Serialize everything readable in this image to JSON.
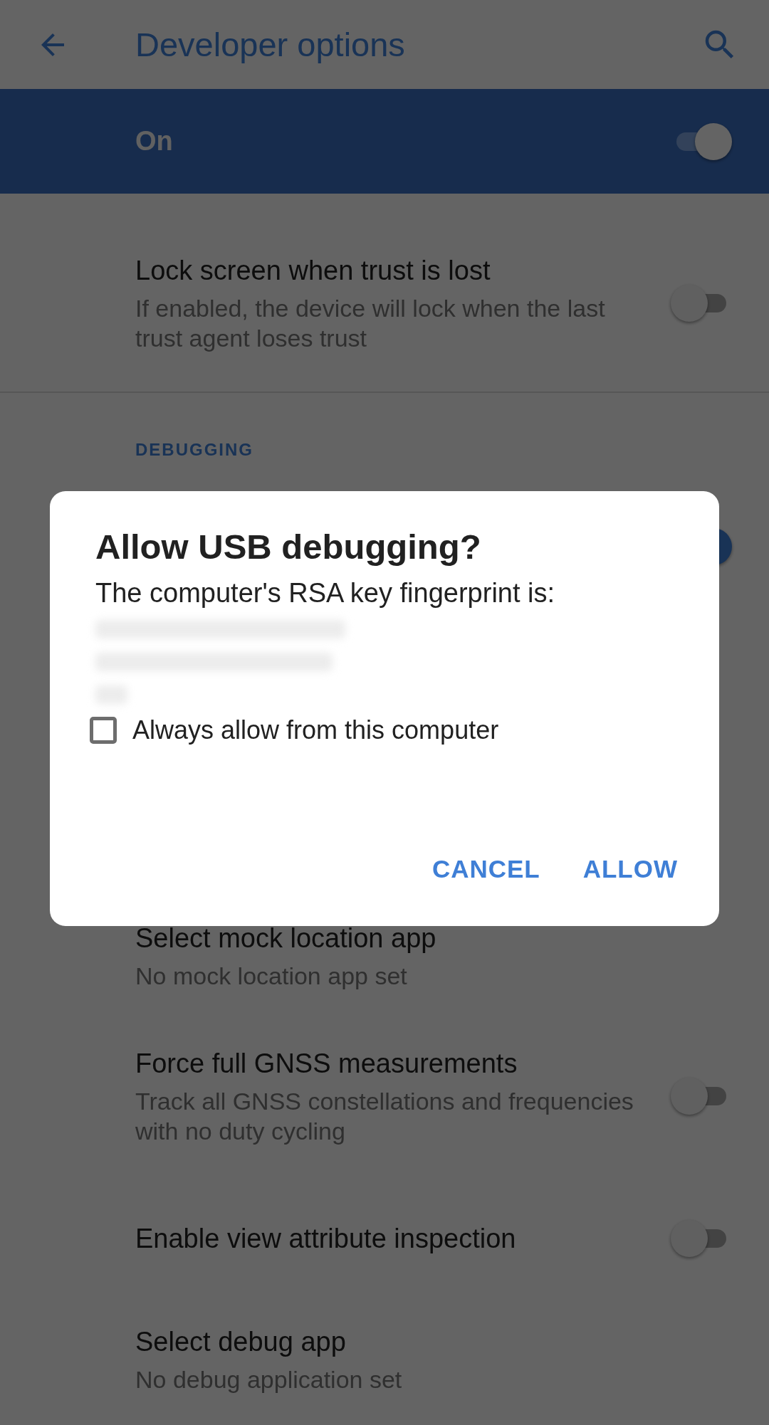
{
  "app_bar": {
    "title": "Developer options"
  },
  "main_switch": {
    "label": "On",
    "on": true
  },
  "settings": [
    {
      "kind": "toggle",
      "title": "Lock screen when trust is lost",
      "summary": "If enabled, the device will lock when the last trust agent loses trust",
      "on": false
    },
    {
      "kind": "header",
      "title": "DEBUGGING"
    },
    {
      "kind": "covered",
      "on": true
    },
    {
      "kind": "text",
      "title": "Select mock location app",
      "summary": "No mock location app set"
    },
    {
      "kind": "toggle",
      "title": "Force full GNSS measurements",
      "summary": "Track all GNSS constellations and frequencies with no duty cycling",
      "on": false
    },
    {
      "kind": "toggle",
      "title": "Enable view attribute inspection",
      "on": false
    },
    {
      "kind": "text",
      "title": "Select debug app",
      "summary": "No debug application set"
    }
  ],
  "dialog": {
    "title": "Allow USB debugging?",
    "message": "The computer's RSA key fingerprint is:",
    "checkbox": {
      "label": "Always allow from this computer",
      "checked": false
    },
    "buttons": [
      "CANCEL",
      "ALLOW"
    ]
  }
}
